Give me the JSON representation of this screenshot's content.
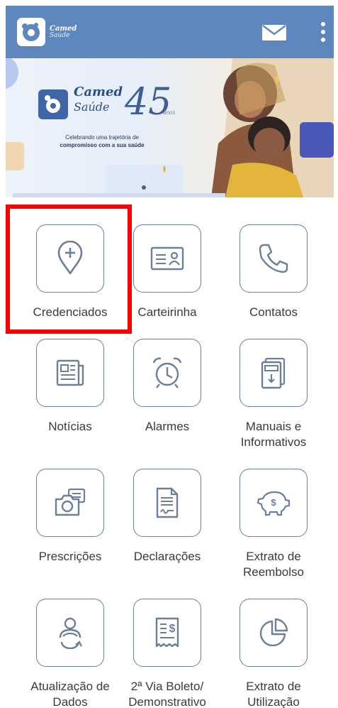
{
  "header": {
    "brand_name": "Camed",
    "brand_sub": "Saúde",
    "mail_icon": "mail-icon",
    "menu_icon": "more-vertical-icon",
    "background": "#5e88bd"
  },
  "banner": {
    "brand_name": "Camed",
    "brand_sub": "Saúde",
    "years": "45",
    "years_suffix": "anos",
    "tagline_line1": "Celebrando uma trajetória de",
    "tagline_line2": "compromisso com a sua saúde"
  },
  "menu": {
    "items": [
      {
        "label": "Credenciados",
        "icon": "location-pin-plus-icon"
      },
      {
        "label": "Carteirinha",
        "icon": "id-card-icon"
      },
      {
        "label": "Contatos",
        "icon": "phone-icon"
      },
      {
        "label": "Notícias",
        "icon": "newspaper-icon"
      },
      {
        "label": "Alarmes",
        "icon": "alarm-clock-icon"
      },
      {
        "label": "Manuais e Informativos",
        "icon": "manual-book-icon"
      },
      {
        "label": "Prescrições",
        "icon": "camera-photos-icon"
      },
      {
        "label": "Declarações",
        "icon": "document-signature-icon"
      },
      {
        "label": "Extrato de Reembolso",
        "icon": "piggy-bank-icon"
      },
      {
        "label": "Atualização de Dados",
        "icon": "user-refresh-icon"
      },
      {
        "label": "2ª Via Boleto/ Demonstrativo",
        "icon": "receipt-dollar-icon"
      },
      {
        "label": "Extrato de Utilização",
        "icon": "pie-chart-icon"
      }
    ]
  },
  "highlight_color": "#ff0000",
  "icon_color": "#6b7f99"
}
